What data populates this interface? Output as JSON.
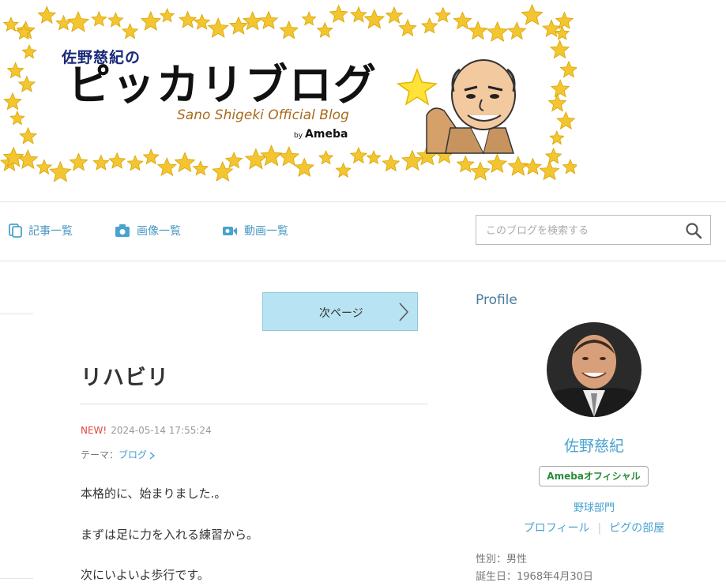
{
  "banner": {
    "title_small": "佐野慈紀の",
    "title_big": "ピッカリブログ",
    "subtitle": "Sano Shigeki Official Blog",
    "by_prefix": "by",
    "by_brand": "Ameba"
  },
  "nav": {
    "items": [
      {
        "label": "記事一覧",
        "icon": "document-list-icon"
      },
      {
        "label": "画像一覧",
        "icon": "camera-icon"
      },
      {
        "label": "動画一覧",
        "icon": "video-camera-icon"
      }
    ],
    "search_placeholder": "このブログを検索する"
  },
  "pager": {
    "next_label": "次ページ"
  },
  "entry": {
    "title": "リハビリ",
    "new_label": "NEW!",
    "datetime": "2024-05-14 17:55:24",
    "theme_label": "テーマ：",
    "theme_value": "ブログ",
    "lines": [
      "本格的に、始まりました.。",
      "まずは足に力を入れる練習から。",
      "次にいよいよ歩行です。"
    ]
  },
  "sidebar": {
    "heading": "Profile",
    "name": "佐野慈紀",
    "badge": "Amebaオフィシャル",
    "category": "野球部門",
    "links": [
      "プロフィール",
      "ピグの部屋"
    ],
    "gender": "性別：男性",
    "birthday": "誕生日：1968年4月30日"
  },
  "colors": {
    "accent": "#4aa3cf",
    "nav_text": "#4a98c2",
    "pager_bg": "#b8e3f2",
    "new_red": "#e0483f",
    "badge_green": "#2a8a3a",
    "star_gold": "#f2c531"
  }
}
